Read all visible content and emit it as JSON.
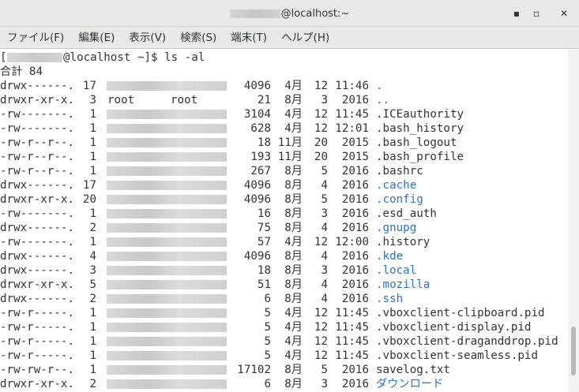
{
  "window": {
    "title_suffix": "@localhost:~",
    "minimize": "▪",
    "maximize": "▫",
    "close": "✕"
  },
  "menu": [
    {
      "label": "ファイル(F)"
    },
    {
      "label": "編集(E)"
    },
    {
      "label": "表示(V)"
    },
    {
      "label": "検索(S)"
    },
    {
      "label": "端末(T)"
    },
    {
      "label": "ヘルプ(H)"
    }
  ],
  "terminal": {
    "prompt_open": "[",
    "prompt_rest": "@localhost ~]$ ls -al",
    "total": "合計 84",
    "rows": [
      {
        "perm": "drwx------.",
        "links": "17",
        "owner": "",
        "group": "",
        "size": "4096",
        "month": "4月",
        "day": "12",
        "time": "11:46",
        "name": ".",
        "is_dir": true
      },
      {
        "perm": "drwxr-xr-x.",
        "links": "3",
        "owner": "root",
        "group": "root",
        "size": "21",
        "month": "8月",
        "day": "3",
        "time": "2016",
        "name": "..",
        "is_dir": true
      },
      {
        "perm": "-rw-------.",
        "links": "1",
        "owner": "",
        "group": "",
        "size": "3104",
        "month": "4月",
        "day": "12",
        "time": "11:45",
        "name": ".ICEauthority",
        "is_dir": false
      },
      {
        "perm": "-rw-------.",
        "links": "1",
        "owner": "",
        "group": "",
        "size": "628",
        "month": "4月",
        "day": "12",
        "time": "12:01",
        "name": ".bash_history",
        "is_dir": false
      },
      {
        "perm": "-rw-r--r--.",
        "links": "1",
        "owner": "",
        "group": "",
        "size": "18",
        "month": "11月",
        "day": "20",
        "time": "2015",
        "name": ".bash_logout",
        "is_dir": false
      },
      {
        "perm": "-rw-r--r--.",
        "links": "1",
        "owner": "",
        "group": "",
        "size": "193",
        "month": "11月",
        "day": "20",
        "time": "2015",
        "name": ".bash_profile",
        "is_dir": false
      },
      {
        "perm": "-rw-r--r--.",
        "links": "1",
        "owner": "",
        "group": "",
        "size": "267",
        "month": "8月",
        "day": "5",
        "time": "2016",
        "name": ".bashrc",
        "is_dir": false
      },
      {
        "perm": "drwx------.",
        "links": "17",
        "owner": "",
        "group": "",
        "size": "4096",
        "month": "8月",
        "day": "4",
        "time": "2016",
        "name": ".cache",
        "is_dir": true
      },
      {
        "perm": "drwxr-xr-x.",
        "links": "20",
        "owner": "",
        "group": "",
        "size": "4096",
        "month": "8月",
        "day": "5",
        "time": "2016",
        "name": ".config",
        "is_dir": true
      },
      {
        "perm": "-rw-------.",
        "links": "1",
        "owner": "",
        "group": "",
        "size": "16",
        "month": "8月",
        "day": "3",
        "time": "2016",
        "name": ".esd_auth",
        "is_dir": false
      },
      {
        "perm": "drwx------.",
        "links": "2",
        "owner": "",
        "group": "",
        "size": "75",
        "month": "8月",
        "day": "4",
        "time": "2016",
        "name": ".gnupg",
        "is_dir": true
      },
      {
        "perm": "-rw-------.",
        "links": "1",
        "owner": "",
        "group": "",
        "size": "57",
        "month": "4月",
        "day": "12",
        "time": "12:00",
        "name": ".history",
        "is_dir": false
      },
      {
        "perm": "drwx------.",
        "links": "4",
        "owner": "",
        "group": "",
        "size": "4096",
        "month": "8月",
        "day": "4",
        "time": "2016",
        "name": ".kde",
        "is_dir": true
      },
      {
        "perm": "drwx------.",
        "links": "3",
        "owner": "",
        "group": "",
        "size": "18",
        "month": "8月",
        "day": "3",
        "time": "2016",
        "name": ".local",
        "is_dir": true
      },
      {
        "perm": "drwxr-xr-x.",
        "links": "5",
        "owner": "",
        "group": "",
        "size": "51",
        "month": "8月",
        "day": "4",
        "time": "2016",
        "name": ".mozilla",
        "is_dir": true
      },
      {
        "perm": "drwx------.",
        "links": "2",
        "owner": "",
        "group": "",
        "size": "6",
        "month": "8月",
        "day": "4",
        "time": "2016",
        "name": ".ssh",
        "is_dir": true
      },
      {
        "perm": "-rw-r-----.",
        "links": "1",
        "owner": "",
        "group": "",
        "size": "5",
        "month": "4月",
        "day": "12",
        "time": "11:45",
        "name": ".vboxclient-clipboard.pid",
        "is_dir": false
      },
      {
        "perm": "-rw-r-----.",
        "links": "1",
        "owner": "",
        "group": "",
        "size": "5",
        "month": "4月",
        "day": "12",
        "time": "11:45",
        "name": ".vboxclient-display.pid",
        "is_dir": false
      },
      {
        "perm": "-rw-r-----.",
        "links": "1",
        "owner": "",
        "group": "",
        "size": "5",
        "month": "4月",
        "day": "12",
        "time": "11:45",
        "name": ".vboxclient-draganddrop.pid",
        "is_dir": false
      },
      {
        "perm": "-rw-r-----.",
        "links": "1",
        "owner": "",
        "group": "",
        "size": "5",
        "month": "4月",
        "day": "12",
        "time": "11:45",
        "name": ".vboxclient-seamless.pid",
        "is_dir": false
      },
      {
        "perm": "-rw-rw-r--.",
        "links": "1",
        "owner": "",
        "group": "",
        "size": "17102",
        "month": "8月",
        "day": "5",
        "time": "2016",
        "name": "savelog.txt",
        "is_dir": false
      },
      {
        "perm": "drwxr-xr-x.",
        "links": "2",
        "owner": "",
        "group": "",
        "size": "6",
        "month": "8月",
        "day": "3",
        "time": "2016",
        "name": "ダウンロード",
        "is_dir": true
      }
    ]
  },
  "colors": {
    "directory": "#2a6fd2",
    "text": "#2e3436",
    "chrome": "#e8e8e7"
  }
}
